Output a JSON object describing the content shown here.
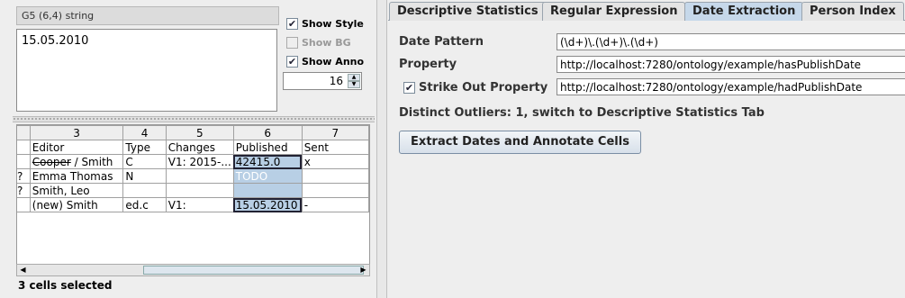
{
  "cell_editor": {
    "cell_ref": "G5 (6,4) string",
    "value": "15.05.2010"
  },
  "options": {
    "show_style": "Show Style",
    "show_bg": "Show BG",
    "show_anno": "Show Anno",
    "spinner_value": "16"
  },
  "grid": {
    "col_numbers": [
      "3",
      "4",
      "5",
      "6",
      "7"
    ],
    "rows": [
      {
        "marker": "",
        "cells": [
          "Editor",
          "Type",
          "Changes",
          "Published",
          "Sent"
        ]
      },
      {
        "marker": "",
        "cells": [
          "Cooper / Smith",
          "C",
          "V1: 2015-...",
          "42415.0",
          "x"
        ]
      },
      {
        "marker": "?",
        "cells": [
          "Emma Thomas",
          "N",
          "",
          "TODO",
          ""
        ]
      },
      {
        "marker": "?",
        "cells": [
          "Smith, Leo",
          "",
          "",
          "",
          ""
        ]
      },
      {
        "marker": "",
        "cells": [
          "(new) Smith",
          "ed.c",
          "V1:",
          "15.05.2010",
          "-"
        ]
      }
    ],
    "struck_text": "Cooper",
    "struck_rest": " / Smith"
  },
  "status": "3 cells selected",
  "tabs": [
    {
      "label": "Descriptive Statistics"
    },
    {
      "label": "Regular Expression"
    },
    {
      "label": "Date Extraction"
    },
    {
      "label": "Person Index"
    }
  ],
  "form": {
    "date_pattern_label": "Date Pattern",
    "date_pattern_value": "(\\d+)\\.(\\d+)\\.(\\d+)",
    "property_label": "Property",
    "property_value": "http://localhost:7280/ontology/example/hasPublishDate",
    "strike_label": "Strike Out Property",
    "strike_value": "http://localhost:7280/ontology/example/hadPublishDate",
    "outliers_text": "Distinct Outliers: 1, switch to Descriptive Statistics Tab",
    "extract_button": "Extract Dates and Annotate Cells"
  },
  "colors": {
    "selection": "#b8cfe5",
    "active_tab": "#c6d8ea"
  }
}
